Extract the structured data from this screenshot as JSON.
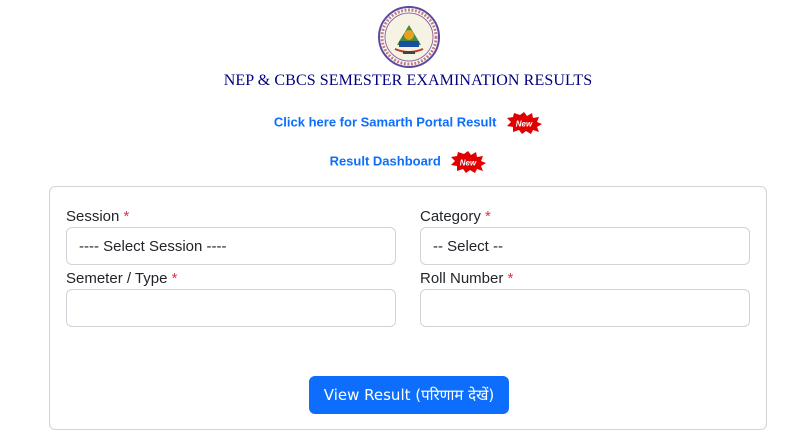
{
  "header": {
    "title": "NEP & CBCS SEMESTER EXAMINATION RESULTS",
    "logo_icon": "university-seal"
  },
  "links": {
    "samarth": "Click here for Samarth Portal Result",
    "dashboard": "Result Dashboard",
    "new_badge": "New"
  },
  "form": {
    "session_label": "Session",
    "session_value": "---- Select Session ----",
    "category_label": "Category",
    "category_value": "-- Select --",
    "semester_label": "Semeter / Type",
    "semester_value": "",
    "roll_label": "Roll Number",
    "roll_value": "",
    "required_mark": "*",
    "submit_label": "View Result (परिणाम देखें)"
  },
  "colors": {
    "title": "#000080",
    "link": "#0d6efd",
    "required": "#dc3545",
    "button": "#0d6efd",
    "badge": "#e00000"
  }
}
